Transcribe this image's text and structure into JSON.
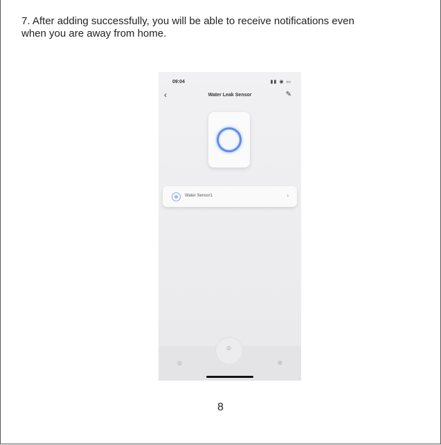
{
  "instruction": {
    "line1": "7. After adding successfully, you will be able to receive notifications even",
    "line2": "when you are away from home."
  },
  "phone": {
    "status_time": "09:04",
    "nav_title": "Water Leak Sensor",
    "sensor_label": "Water Sensor1"
  },
  "page_number": "8",
  "colors": {
    "accent_blue": "#5d8cf0",
    "phone_background": "#efeff2"
  },
  "icons": [
    "back-icon",
    "edit-icon",
    "water-drop-icon",
    "chevron-right-icon",
    "home-tab-icon",
    "scene-tab-icon",
    "settings-tab-icon"
  ]
}
